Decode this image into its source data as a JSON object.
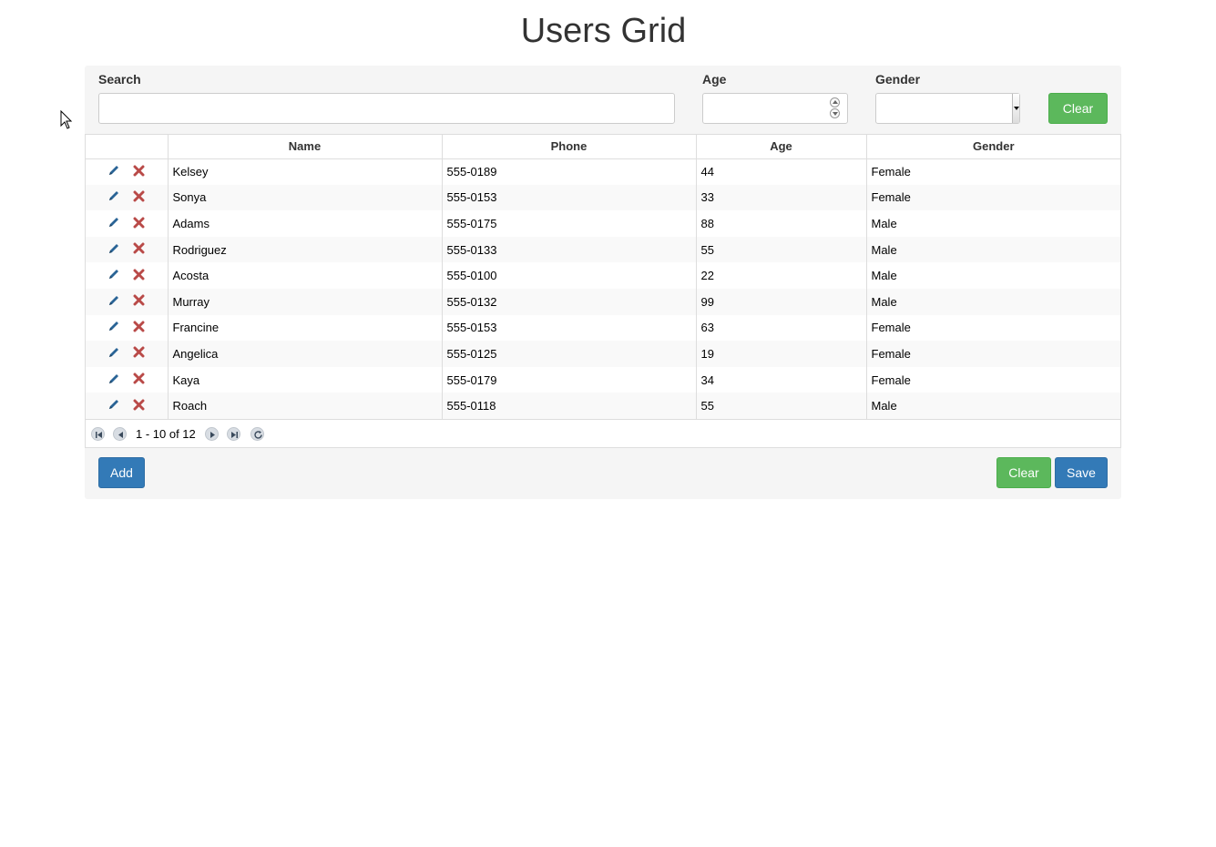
{
  "title": "Users Grid",
  "filters": {
    "search_label": "Search",
    "search_value": "",
    "age_label": "Age",
    "age_value": "",
    "gender_label": "Gender",
    "gender_value": "",
    "clear_label": "Clear"
  },
  "grid": {
    "columns": [
      "Name",
      "Phone",
      "Age",
      "Gender"
    ],
    "rows": [
      {
        "name": "Kelsey",
        "phone": "555-0189",
        "age": "44",
        "gender": "Female"
      },
      {
        "name": "Sonya",
        "phone": "555-0153",
        "age": "33",
        "gender": "Female"
      },
      {
        "name": "Adams",
        "phone": "555-0175",
        "age": "88",
        "gender": "Male"
      },
      {
        "name": "Rodriguez",
        "phone": "555-0133",
        "age": "55",
        "gender": "Male"
      },
      {
        "name": "Acosta",
        "phone": "555-0100",
        "age": "22",
        "gender": "Male"
      },
      {
        "name": "Murray",
        "phone": "555-0132",
        "age": "99",
        "gender": "Male"
      },
      {
        "name": "Francine",
        "phone": "555-0153",
        "age": "63",
        "gender": "Female"
      },
      {
        "name": "Angelica",
        "phone": "555-0125",
        "age": "19",
        "gender": "Female"
      },
      {
        "name": "Kaya",
        "phone": "555-0179",
        "age": "34",
        "gender": "Female"
      },
      {
        "name": "Roach",
        "phone": "555-0118",
        "age": "55",
        "gender": "Male"
      }
    ],
    "row_icons": [
      "pencil-icon",
      "delete-icon"
    ],
    "pager": {
      "info": "1 - 10 of 12",
      "icons": [
        "first-page-icon",
        "prev-page-icon",
        "next-page-icon",
        "last-page-icon",
        "refresh-icon"
      ]
    }
  },
  "footer": {
    "add_label": "Add",
    "clear_label": "Clear",
    "save_label": "Save"
  },
  "colors": {
    "success": "#5cb85c",
    "primary": "#337ab7",
    "edit_icon": "#2a6496",
    "delete_icon": "#b94a48"
  }
}
